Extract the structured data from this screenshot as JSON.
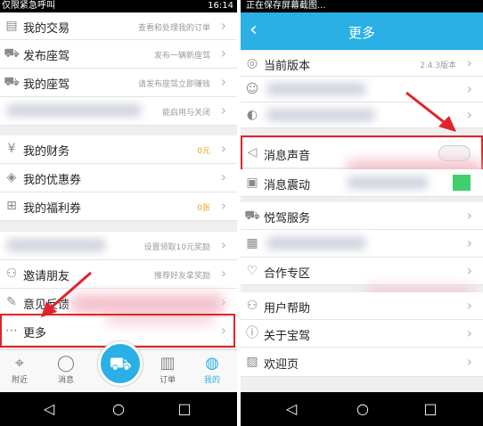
{
  "left": {
    "status": {
      "left": "仅限紧急呼叫",
      "time": "16:14"
    },
    "menu": [
      {
        "label": "我的交易",
        "hint": "查看和处理我的订单"
      },
      {
        "label": "发布座驾",
        "hint": "发布一辆新座驾"
      },
      {
        "label": "我的座驾",
        "hint": "请发布座驾立即赚钱"
      },
      {
        "label": "",
        "hint": "能启用与关闭"
      },
      {
        "label": "我的财务",
        "hint": "0元"
      },
      {
        "label": "我的优惠券",
        "hint": ""
      },
      {
        "label": "我的福利券",
        "hint": "0张"
      },
      {
        "label": "",
        "hint": "设置领取10元奖励"
      },
      {
        "label": "邀请朋友",
        "hint": "推荐好友拿奖励"
      },
      {
        "label": "意见反馈",
        "hint": ""
      },
      {
        "label": "更多",
        "hint": ""
      }
    ],
    "tabs": [
      {
        "label": "附近"
      },
      {
        "label": "消息"
      },
      {
        "label": ""
      },
      {
        "label": "订单"
      },
      {
        "label": "我的"
      }
    ],
    "colors": {
      "accent": "#2ab0e4",
      "finance": "#f0a020"
    }
  },
  "right": {
    "status": {
      "left": "正在保存屏幕截图...",
      "time": ""
    },
    "title": "更多",
    "rows": [
      {
        "label": "当前版本",
        "value": "2.4.3版本"
      },
      {
        "label": "",
        "value": ""
      },
      {
        "label": "",
        "value": ""
      },
      {
        "label": "消息声音",
        "value": ""
      },
      {
        "label": "消息震动",
        "value": ""
      },
      {
        "label": "悦驾服务",
        "value": ""
      },
      {
        "label": "",
        "value": ""
      },
      {
        "label": "合作专区",
        "value": ""
      },
      {
        "label": "用户帮助",
        "value": ""
      },
      {
        "label": "关于宝驾",
        "value": ""
      },
      {
        "label": "欢迎页",
        "value": ""
      }
    ]
  }
}
